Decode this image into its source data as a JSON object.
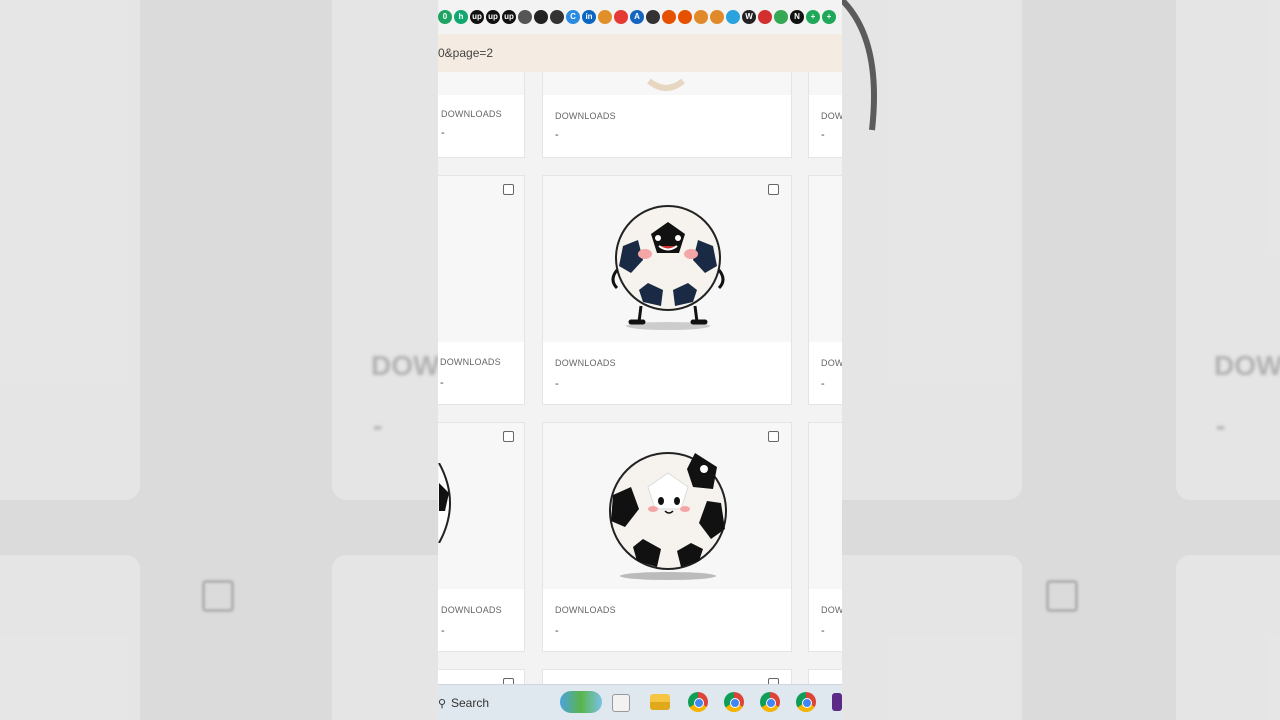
{
  "browser": {
    "address_text": "0&page=2"
  },
  "bookmarks": [
    {
      "icon": "green-circle-icon",
      "color": "#1da462",
      "glyph": "0"
    },
    {
      "icon": "green-h-icon",
      "color": "#0fa86e",
      "glyph": "h"
    },
    {
      "icon": "upwork-icon",
      "color": "#111111",
      "glyph": "up"
    },
    {
      "icon": "upwork-icon",
      "color": "#111111",
      "glyph": "up"
    },
    {
      "icon": "upwork-icon",
      "color": "#111111",
      "glyph": "up"
    },
    {
      "icon": "globe-icon",
      "color": "#555555",
      "glyph": ""
    },
    {
      "icon": "block-icon",
      "color": "#222222",
      "glyph": ""
    },
    {
      "icon": "square-icon",
      "color": "#333333",
      "glyph": ""
    },
    {
      "icon": "c-circle-icon",
      "color": "#2a8be0",
      "glyph": "C"
    },
    {
      "icon": "linkedin-icon",
      "color": "#0a66c2",
      "glyph": "in"
    },
    {
      "icon": "fox-icon",
      "color": "#e0902a",
      "glyph": ""
    },
    {
      "icon": "no-entry-icon",
      "color": "#e53935",
      "glyph": ""
    },
    {
      "icon": "a-icon",
      "color": "#1565c0",
      "glyph": "A"
    },
    {
      "icon": "white-box-icon",
      "color": "#333333",
      "glyph": ""
    },
    {
      "icon": "triangle-icon",
      "color": "#e65100",
      "glyph": ""
    },
    {
      "icon": "triangle-icon",
      "color": "#e65100",
      "glyph": ""
    },
    {
      "icon": "bars-icon",
      "color": "#e08a2a",
      "glyph": ""
    },
    {
      "icon": "bars-icon",
      "color": "#e08a2a",
      "glyph": ""
    },
    {
      "icon": "telegram-icon",
      "color": "#2aa3df",
      "glyph": ""
    },
    {
      "icon": "w-icon",
      "color": "#222222",
      "glyph": "W"
    },
    {
      "icon": "rainbow-icon",
      "color": "#d32f2f",
      "glyph": ""
    },
    {
      "icon": "drive-icon",
      "color": "#34a853",
      "glyph": ""
    },
    {
      "icon": "notion-icon",
      "color": "#111111",
      "glyph": "N"
    },
    {
      "icon": "plus-icon",
      "color": "#1fa85a",
      "glyph": "+"
    },
    {
      "icon": "plus-icon",
      "color": "#1fa85a",
      "glyph": "+"
    }
  ],
  "cards": {
    "label": "DOWNLOADS",
    "value": "-"
  },
  "side_text": {
    "left": "DOWN",
    "right": "DOW"
  },
  "taskbar": {
    "search_label": "Search"
  }
}
